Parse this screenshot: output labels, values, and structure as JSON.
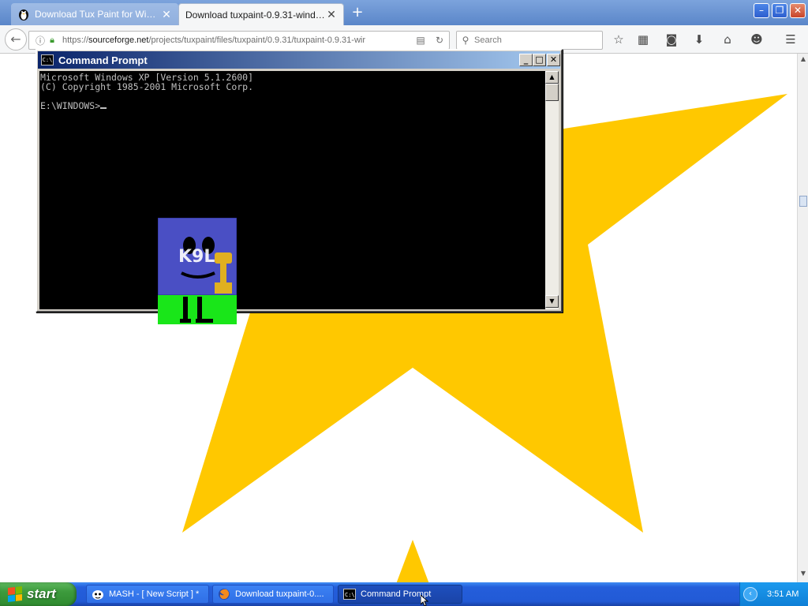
{
  "browser": {
    "tabs": [
      {
        "label": "Download Tux Paint for Wind…",
        "active": false,
        "favicon": "tux-penguin-icon"
      },
      {
        "label": "Download tuxpaint-0.9.31-windo…",
        "active": true,
        "favicon": ""
      }
    ],
    "new_tab_label": "+",
    "window_controls": {
      "minimize": "–",
      "restore": "❐",
      "close": "✕"
    },
    "url_prefix": "https://",
    "url_domain": "sourceforge.net",
    "url_path": "/projects/tuxpaint/files/tuxpaint/0.9.31/tuxpaint-0.9.31-wir",
    "search_placeholder": "Search"
  },
  "page": {
    "background": "#ffffff",
    "star_color": "#ffc800"
  },
  "cmd_window": {
    "title": "Command Prompt",
    "icon_text": "C:\\",
    "lines": [
      "Microsoft Windows XP [Version 5.1.2600]",
      "(C) Copyright 1985-2001 Microsoft Corp.",
      "",
      "E:\\WINDOWS>"
    ],
    "controls": {
      "minimize": "_",
      "maximize": "□",
      "close": "✕"
    }
  },
  "taskbar": {
    "start_label": "start",
    "buttons": [
      {
        "label": "MASH - [ New Script ] *",
        "icon": "mash-icon",
        "active": false
      },
      {
        "label": "Download tuxpaint-0....",
        "icon": "firefox-icon",
        "active": false
      },
      {
        "label": "Command Prompt",
        "icon": "cmd-icon",
        "active": true
      }
    ],
    "clock": "3:51 AM"
  },
  "colors": {
    "xp_title_blue": "#0a246a",
    "taskbar_blue": "#245edb",
    "start_green": "#3c9a3c",
    "character_body": "#4a4fc4",
    "character_legs_bg": "#19e619",
    "trophy": "#e0b020"
  }
}
